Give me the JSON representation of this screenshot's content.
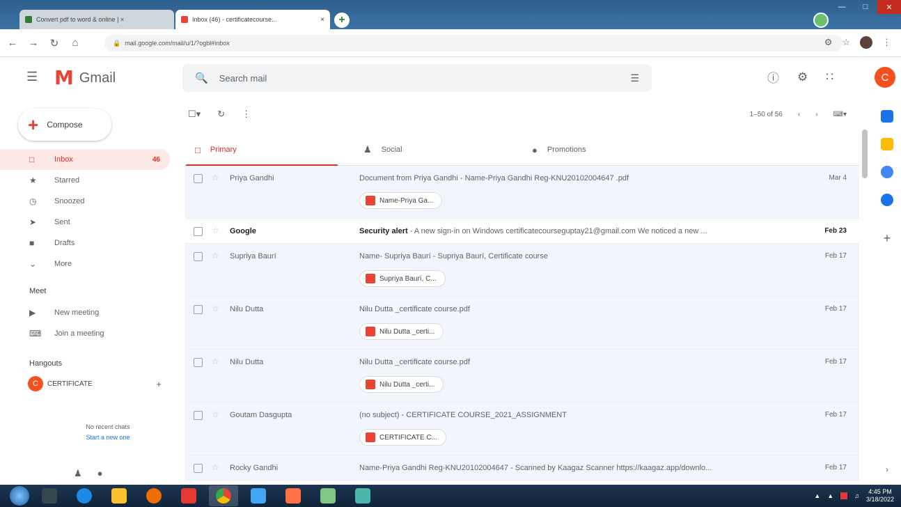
{
  "browser": {
    "tabs": [
      {
        "title": "Convert pdf to word & online | ×",
        "active": false
      },
      {
        "title": "Inbox (46) - certificatecourse...",
        "active": true
      }
    ],
    "url": "mail.google.com/mail/u/1/?ogbl#inbox",
    "tab_close": "×"
  },
  "gmail": {
    "logo_text": "Gmail",
    "search_placeholder": "Search mail",
    "account_initial": "C"
  },
  "sidebar": {
    "compose_label": "Compose",
    "items": [
      {
        "label": "Inbox",
        "count": "46",
        "icon": "inbox-icon",
        "active": true
      },
      {
        "label": "Starred",
        "count": "",
        "icon": "star-icon"
      },
      {
        "label": "Snoozed",
        "count": "",
        "icon": "clock-icon"
      },
      {
        "label": "Sent",
        "count": "",
        "icon": "send-icon"
      },
      {
        "label": "Drafts",
        "count": "",
        "icon": "draft-icon"
      },
      {
        "label": "More",
        "count": "",
        "icon": "chevron-down-icon"
      }
    ],
    "meet_header": "Meet",
    "meet_items": [
      {
        "label": "New meeting",
        "icon": "video-icon"
      },
      {
        "label": "Join a meeting",
        "icon": "keyboard-icon"
      }
    ],
    "hangouts_header": "Hangouts",
    "hangouts_user": "CERTIFICATE",
    "hangouts_initial": "C",
    "no_chats": "No recent chats",
    "start_new": "Start a new one"
  },
  "toolbar": {
    "pager_text": "1–50 of 56"
  },
  "categories": [
    {
      "label": "Primary",
      "icon": "inbox-icon",
      "active": true
    },
    {
      "label": "Social",
      "icon": "people-icon",
      "active": false
    },
    {
      "label": "Promotions",
      "icon": "tag-icon",
      "active": false
    }
  ],
  "emails": [
    {
      "sender": "Priya Gandhi",
      "subject": "Document from Priya Gandhi",
      "snippet": " - Name-Priya Gandhi Reg-KNU20102004647 .pdf",
      "date": "Mar 4",
      "attachment": "Name-Priya Ga...",
      "unread": false
    },
    {
      "sender": "Google",
      "subject": "Security alert",
      "snippet": " - A new sign-in on Windows certificatecourseguptay21@gmail.com We noticed a new ...",
      "date": "Feb 23",
      "attachment": "",
      "unread": true
    },
    {
      "sender": "Supriya Baurí",
      "subject": "Name- Supriya Baurí",
      "snippet": " - Supriya Baurí, Certificate course",
      "date": "Feb 17",
      "attachment": "Supriya Baurí, C...",
      "unread": false
    },
    {
      "sender": "Nilu Dutta",
      "subject": "Nilu Dutta _certificate course.pdf",
      "snippet": "",
      "date": "Feb 17",
      "attachment": "Nilu Dutta _certi...",
      "unread": false
    },
    {
      "sender": "Nilu Dutta",
      "subject": "Nilu Dutta _certificate course.pdf",
      "snippet": "",
      "date": "Feb 17",
      "attachment": "Nilu Dutta _certi...",
      "unread": false
    },
    {
      "sender": "Goutam Dasgupta",
      "subject": "(no subject)",
      "snippet": " - CERTIFICATE COURSE_2021_ASSIGNMENT",
      "date": "Feb 17",
      "attachment": "CERTIFICATE C...",
      "unread": false
    },
    {
      "sender": "Rocky Gandhi",
      "subject": "Name-Priya Gandhi Reg-KNU20102004647",
      "snippet": " - Scanned by Kaagaz Scanner https://kaagaz.app/downlo...",
      "date": "Feb 17",
      "attachment": "",
      "unread": false
    }
  ],
  "taskbar": {
    "time": "4:45 PM",
    "date": "3/18/2022"
  },
  "colors": {
    "accent": "#d93025",
    "gmail_red": "#ea4335",
    "avatar": "#f4511e"
  }
}
